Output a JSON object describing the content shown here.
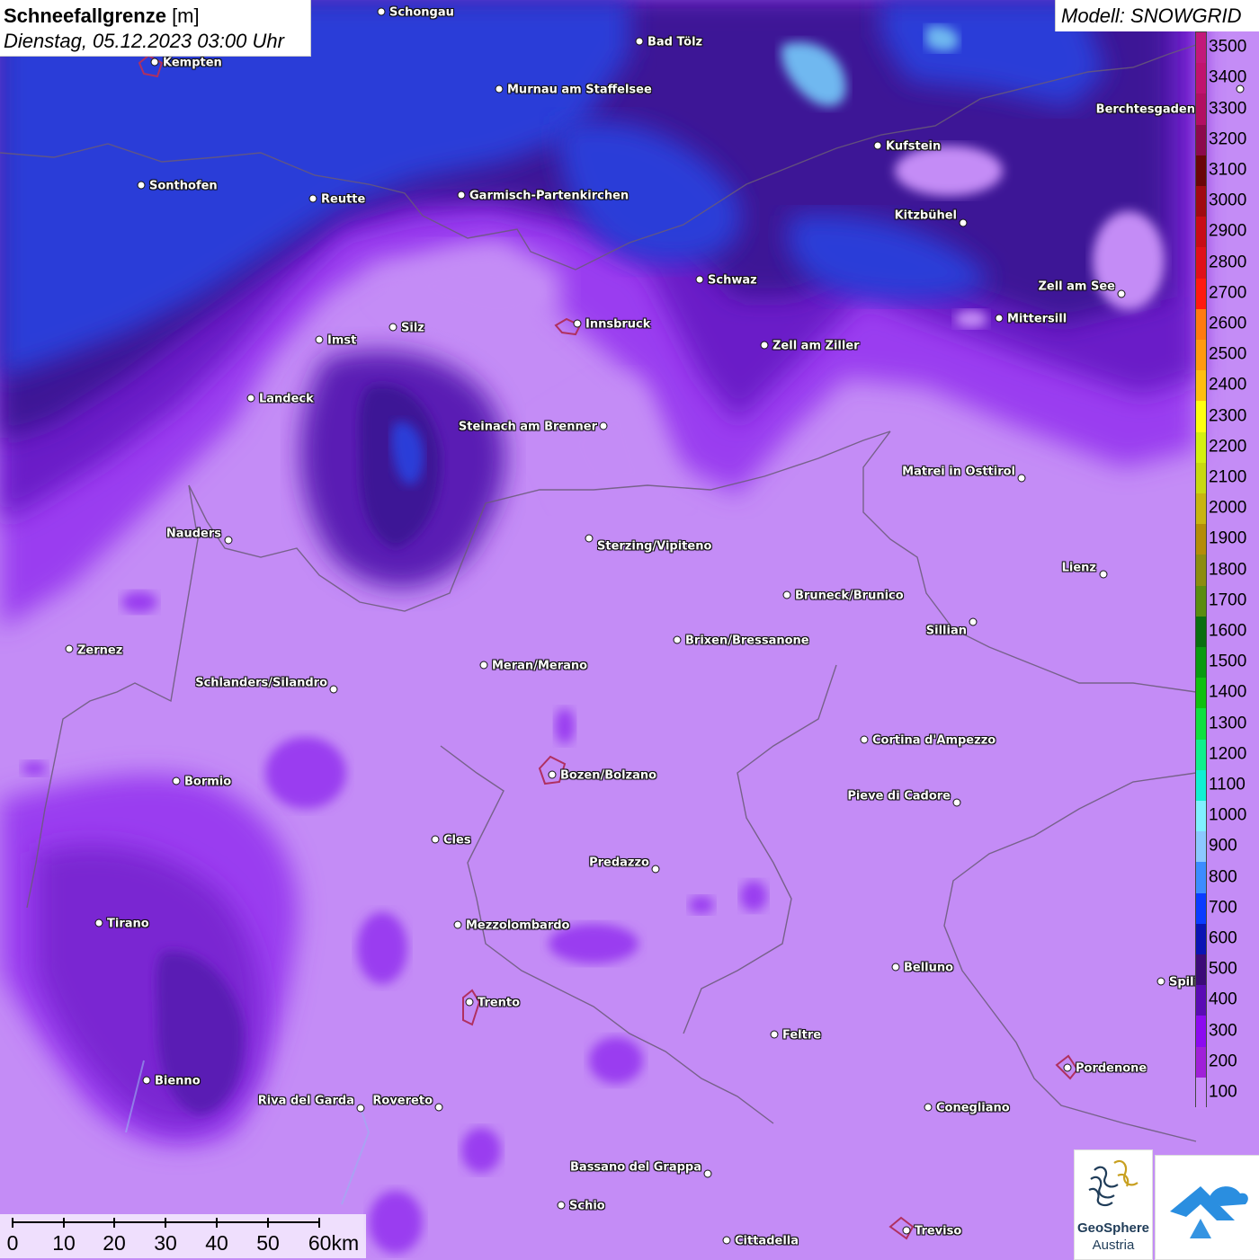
{
  "header": {
    "title_bold": "Schneefallgrenze",
    "title_unit": " [m]",
    "datetime": "Dienstag, 05.12.2023 03:00 Uhr",
    "model_label": "Modell: SNOWGRID"
  },
  "legend": {
    "unit": "m",
    "steps": [
      {
        "value": "3500",
        "color": "#c2187a"
      },
      {
        "value": "3400",
        "color": "#c0136e"
      },
      {
        "value": "3300",
        "color": "#b20f62"
      },
      {
        "value": "3200",
        "color": "#8c0a4c"
      },
      {
        "value": "3100",
        "color": "#6a0508"
      },
      {
        "value": "3000",
        "color": "#a00a12"
      },
      {
        "value": "2900",
        "color": "#c80c16"
      },
      {
        "value": "2800",
        "color": "#e0101a"
      },
      {
        "value": "2700",
        "color": "#ff1a10"
      },
      {
        "value": "2600",
        "color": "#ff7a10"
      },
      {
        "value": "2500",
        "color": "#ff9a10"
      },
      {
        "value": "2400",
        "color": "#ffbe10"
      },
      {
        "value": "2300",
        "color": "#ffff10"
      },
      {
        "value": "2200",
        "color": "#d4f010"
      },
      {
        "value": "2100",
        "color": "#c8d810"
      },
      {
        "value": "2000",
        "color": "#c8b410"
      },
      {
        "value": "1900",
        "color": "#b48c08"
      },
      {
        "value": "1800",
        "color": "#8c8c10"
      },
      {
        "value": "1700",
        "color": "#5a8c10"
      },
      {
        "value": "1600",
        "color": "#0a6e10"
      },
      {
        "value": "1500",
        "color": "#0a9a10"
      },
      {
        "value": "1400",
        "color": "#10c010"
      },
      {
        "value": "1300",
        "color": "#10e040"
      },
      {
        "value": "1200",
        "color": "#10f08c"
      },
      {
        "value": "1100",
        "color": "#10f0d2"
      },
      {
        "value": "1000",
        "color": "#80f0ff"
      },
      {
        "value": "900",
        "color": "#8cc8ff"
      },
      {
        "value": "800",
        "color": "#3c8cff"
      },
      {
        "value": "700",
        "color": "#0a3cff"
      },
      {
        "value": "600",
        "color": "#0a14b4"
      },
      {
        "value": "500",
        "color": "#3c0a78"
      },
      {
        "value": "400",
        "color": "#5a0ab4"
      },
      {
        "value": "300",
        "color": "#8c0af0"
      },
      {
        "value": "200",
        "color": "#a020d8"
      },
      {
        "value": "100",
        "color": "#c88cf8"
      }
    ]
  },
  "cities": [
    {
      "name": "Schongau",
      "side": "right"
    },
    {
      "name": "Kempten",
      "side": "right"
    },
    {
      "name": "Bad Tölz",
      "side": "right"
    },
    {
      "name": "Murnau am Staffelsee",
      "side": "right"
    },
    {
      "name": "Berchtesgaden",
      "side": "left"
    },
    {
      "name": "Kufstein",
      "side": "right"
    },
    {
      "name": "Sonthofen",
      "side": "right"
    },
    {
      "name": "Reutte",
      "side": "right"
    },
    {
      "name": "Garmisch-Partenkirchen",
      "side": "right"
    },
    {
      "name": "Kitzbühel",
      "side": "left"
    },
    {
      "name": "Schwaz",
      "side": "right"
    },
    {
      "name": "Zell am See",
      "side": "left"
    },
    {
      "name": "Innsbruck",
      "side": "right"
    },
    {
      "name": "Mittersill",
      "side": "right"
    },
    {
      "name": "Imst",
      "side": "right"
    },
    {
      "name": "Silz",
      "side": "right"
    },
    {
      "name": "Zell am Ziller",
      "side": "right"
    },
    {
      "name": "Landeck",
      "side": "right"
    },
    {
      "name": "Steinach am Brenner",
      "side": "left"
    },
    {
      "name": "Matrei in Osttirol",
      "side": "left"
    },
    {
      "name": "Nauders",
      "side": "left"
    },
    {
      "name": "Sterzing/Vipiteno",
      "side": "right"
    },
    {
      "name": "Lienz",
      "side": "left"
    },
    {
      "name": "Bruneck/Brunico",
      "side": "right"
    },
    {
      "name": "Sillian",
      "side": "left"
    },
    {
      "name": "Brixen/Bressanone",
      "side": "right"
    },
    {
      "name": "Zernez",
      "side": "right"
    },
    {
      "name": "Meran/Merano",
      "side": "right"
    },
    {
      "name": "Schlanders/Silandro",
      "side": "left"
    },
    {
      "name": "Cortina d'Ampezzo",
      "side": "right"
    },
    {
      "name": "Bozen/Bolzano",
      "side": "right"
    },
    {
      "name": "Bormio",
      "side": "right"
    },
    {
      "name": "Pieve di Cadore",
      "side": "left"
    },
    {
      "name": "Cles",
      "side": "right"
    },
    {
      "name": "Predazzo",
      "side": "left"
    },
    {
      "name": "Tirano",
      "side": "right"
    },
    {
      "name": "Mezzolombardo",
      "side": "right"
    },
    {
      "name": "Belluno",
      "side": "right"
    },
    {
      "name": "Spili",
      "side": "right"
    },
    {
      "name": "Trento",
      "side": "right"
    },
    {
      "name": "Feltre",
      "side": "right"
    },
    {
      "name": "Pordenone",
      "side": "right"
    },
    {
      "name": "Bienno",
      "side": "right"
    },
    {
      "name": "Riva del Garda",
      "side": "left"
    },
    {
      "name": "Rovereto",
      "side": "left"
    },
    {
      "name": "Conegliano",
      "side": "right"
    },
    {
      "name": "Bassano del Grappa",
      "side": "left"
    },
    {
      "name": "Schio",
      "side": "right"
    },
    {
      "name": "Treviso",
      "side": "right"
    },
    {
      "name": "Cittadella",
      "side": "right"
    }
  ],
  "scale_bar": {
    "labels": [
      "0",
      "10",
      "20",
      "30",
      "40",
      "50",
      "60km"
    ]
  },
  "logos": {
    "geosphere_line1": "GeoSphere",
    "geosphere_line2": "Austria"
  }
}
